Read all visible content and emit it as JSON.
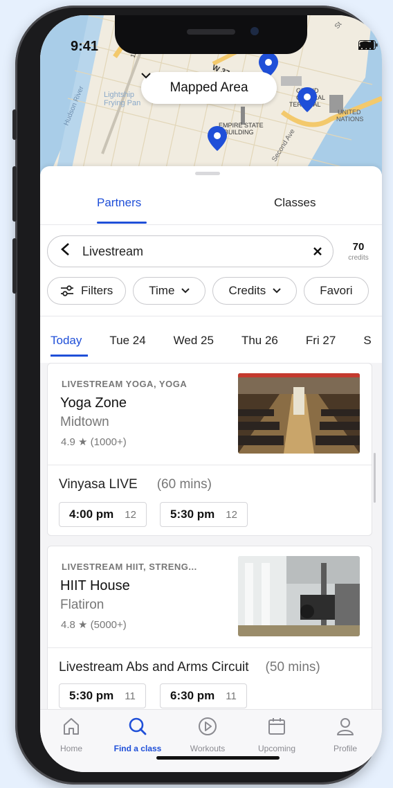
{
  "status": {
    "time": "9:41"
  },
  "map": {
    "pill_label": "Mapped Area",
    "labels": {
      "hudson": "Hudson River",
      "lightship": "Lightship",
      "frying": "Frying Pan",
      "w37": "W 37",
      "grand": "GRAND",
      "central": "CENTRAL",
      "terminal": "TERMINAL",
      "un1": "UNITED",
      "un2": "NATIONS",
      "esb1": "EMPIRE STATE",
      "esb2": "BUILDING",
      "second_ave": "Second Ave",
      "st": "St",
      "twelve": "12"
    },
    "pin_color": "#1f4fd8"
  },
  "tabs": {
    "partners": "Partners",
    "classes": "Classes"
  },
  "search": {
    "value": "Livestream"
  },
  "credits": {
    "count": "70",
    "label": "credits"
  },
  "filters": [
    "Filters",
    "Time",
    "Credits",
    "Favori"
  ],
  "days": [
    "Today",
    "Tue 24",
    "Wed 25",
    "Thu 26",
    "Fri 27",
    "S"
  ],
  "cards": [
    {
      "category": "LIVESTREAM YOGA, YOGA",
      "name": "Yoga Zone",
      "location": "Midtown",
      "rating": "4.9 ★ (1000+)",
      "class_title": "Vinyasa LIVE",
      "duration": "(60 mins)",
      "slots": [
        {
          "time": "4:00 pm",
          "spots": "12"
        },
        {
          "time": "5:30 pm",
          "spots": "12"
        }
      ]
    },
    {
      "category": "LIVESTREAM HIIT, STRENG...",
      "name": "HIIT House",
      "location": "Flatiron",
      "rating": "4.8 ★ (5000+)",
      "class_title": "Livestream Abs and Arms Circuit",
      "duration": "(50 mins)",
      "slots": [
        {
          "time": "5:30 pm",
          "spots": "11"
        },
        {
          "time": "6:30 pm",
          "spots": "11"
        }
      ]
    }
  ],
  "nav": [
    {
      "label": "Home",
      "icon": "home-icon"
    },
    {
      "label": "Find a class",
      "icon": "search-icon"
    },
    {
      "label": "Workouts",
      "icon": "play-icon"
    },
    {
      "label": "Upcoming",
      "icon": "calendar-icon"
    },
    {
      "label": "Profile",
      "icon": "person-icon"
    }
  ],
  "colors": {
    "accent": "#1f4fd8",
    "background": "#e6f0fd"
  }
}
